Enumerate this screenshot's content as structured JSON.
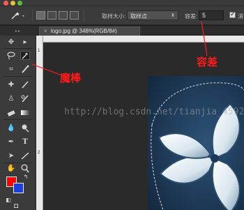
{
  "document_tab": {
    "title": "logo.jpg @ 348%(RGB/8#)",
    "close": "×"
  },
  "options_bar": {
    "sample_size_label": "取样大小:",
    "sample_size_value": "取样点",
    "tolerance_label": "容差:",
    "tolerance_value": "5",
    "antialias_label": "消"
  },
  "annotations": {
    "magic_wand": "魔棒",
    "tolerance": "容差"
  },
  "watermark": "http://blog.csdn.net/tianjia_4592",
  "colors": {
    "foreground": "#ff0000",
    "background": "#1a3fe0",
    "annotation": "#ff1a1a"
  },
  "ruler": {
    "numbers": [
      "1",
      "2"
    ]
  },
  "tools": [
    "move-tool",
    "marquee-tool",
    "lasso-tool",
    "magic-wand-tool",
    "crop-tool",
    "eyedropper-tool",
    "healing-brush-tool",
    "brush-tool",
    "clone-stamp-tool",
    "history-brush-tool",
    "eraser-tool",
    "gradient-tool",
    "blur-tool",
    "dodge-tool",
    "pen-tool",
    "type-tool",
    "path-selection-tool",
    "shape-tool",
    "hand-tool",
    "zoom-tool"
  ]
}
